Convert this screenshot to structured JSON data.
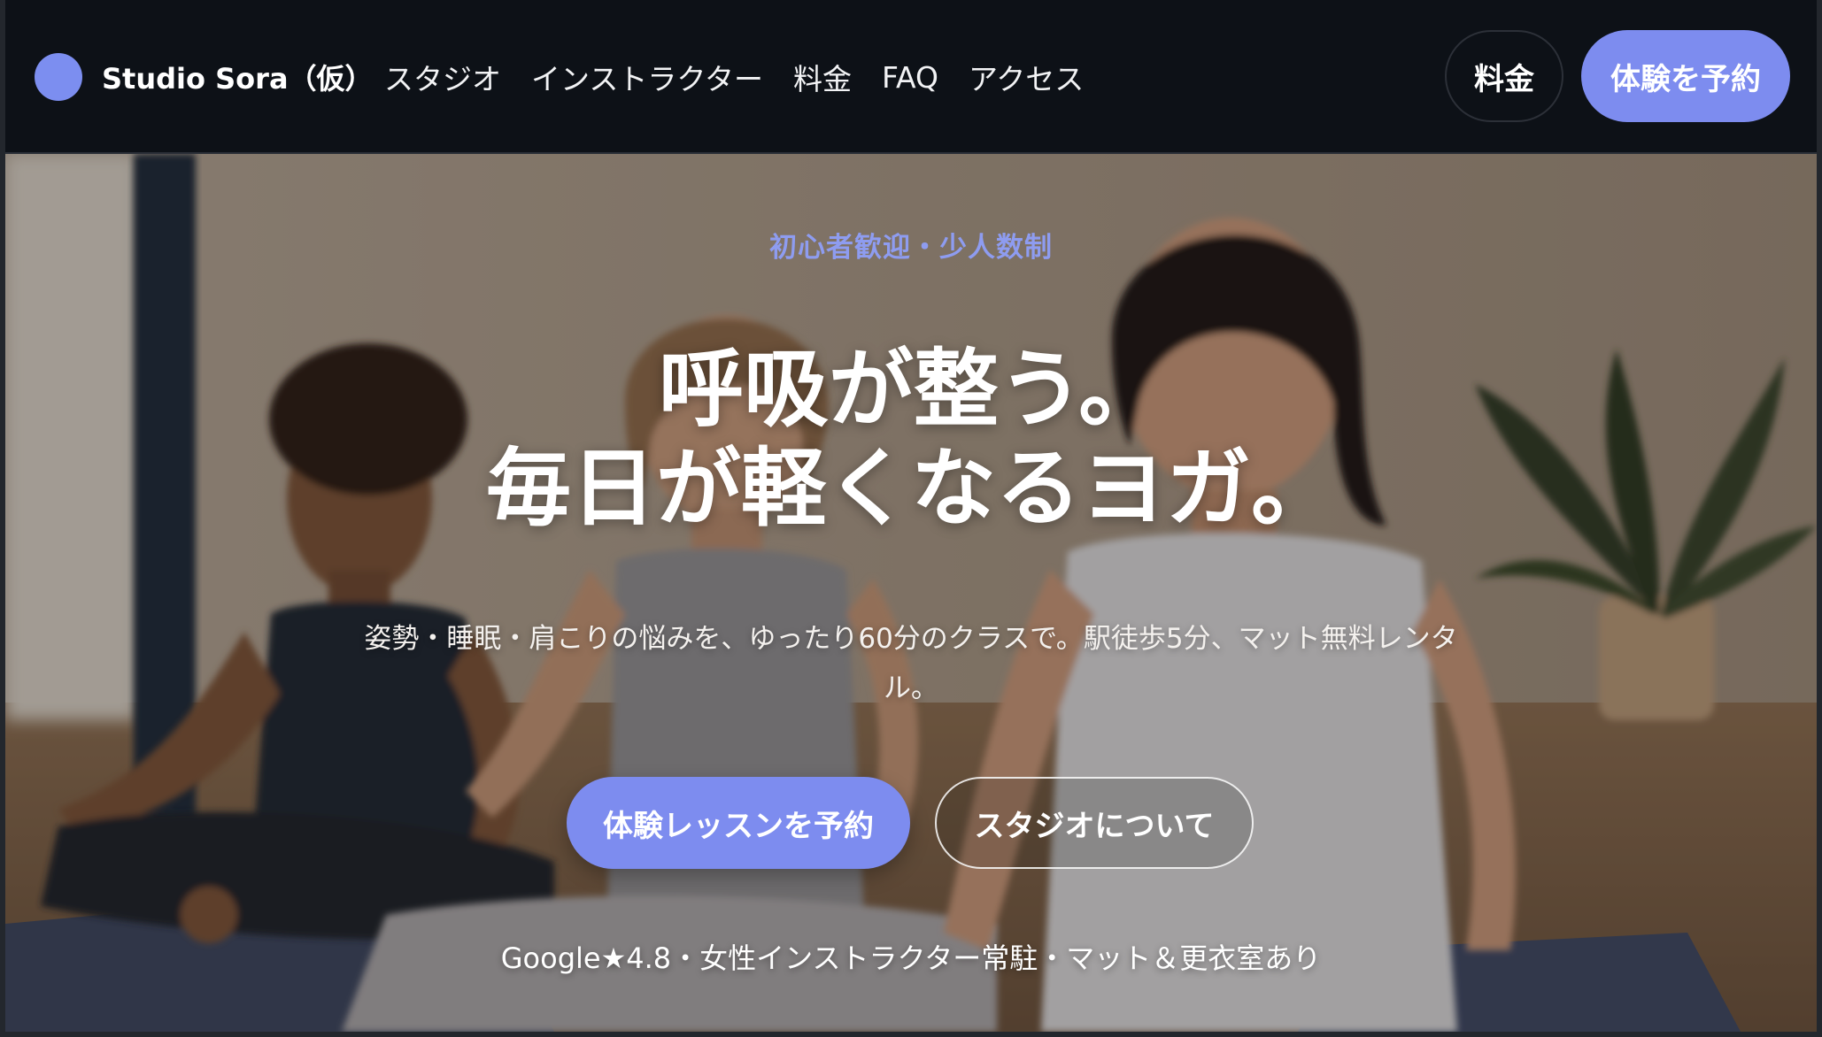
{
  "header": {
    "brand": "Studio Sora（仮）",
    "nav": [
      "スタジオ",
      "インストラクター",
      "料金",
      "FAQ",
      "アクセス"
    ],
    "pricing_button": "料金",
    "trial_button": "体験を予約"
  },
  "hero": {
    "kicker": "初心者歓迎・少人数制",
    "headline_line1": "呼吸が整う。",
    "headline_line2": "毎日が軽くなるヨガ。",
    "lead": "姿勢・睡眠・肩こりの悩みを、ゆったり60分のクラスで。駅徒歩5分、マット無料レンタル。",
    "primary_cta": "体験レッスンを予約",
    "secondary_cta": "スタジオについて",
    "trust_line": "Google★4.8・女性インストラクター常駐・マット＆更衣室あり"
  },
  "colors": {
    "accent": "#7d8cef",
    "kicker": "#8e9cf0",
    "header_bg": "#0d1117"
  },
  "icons": {
    "brand_logo": "circle-logo-icon"
  }
}
